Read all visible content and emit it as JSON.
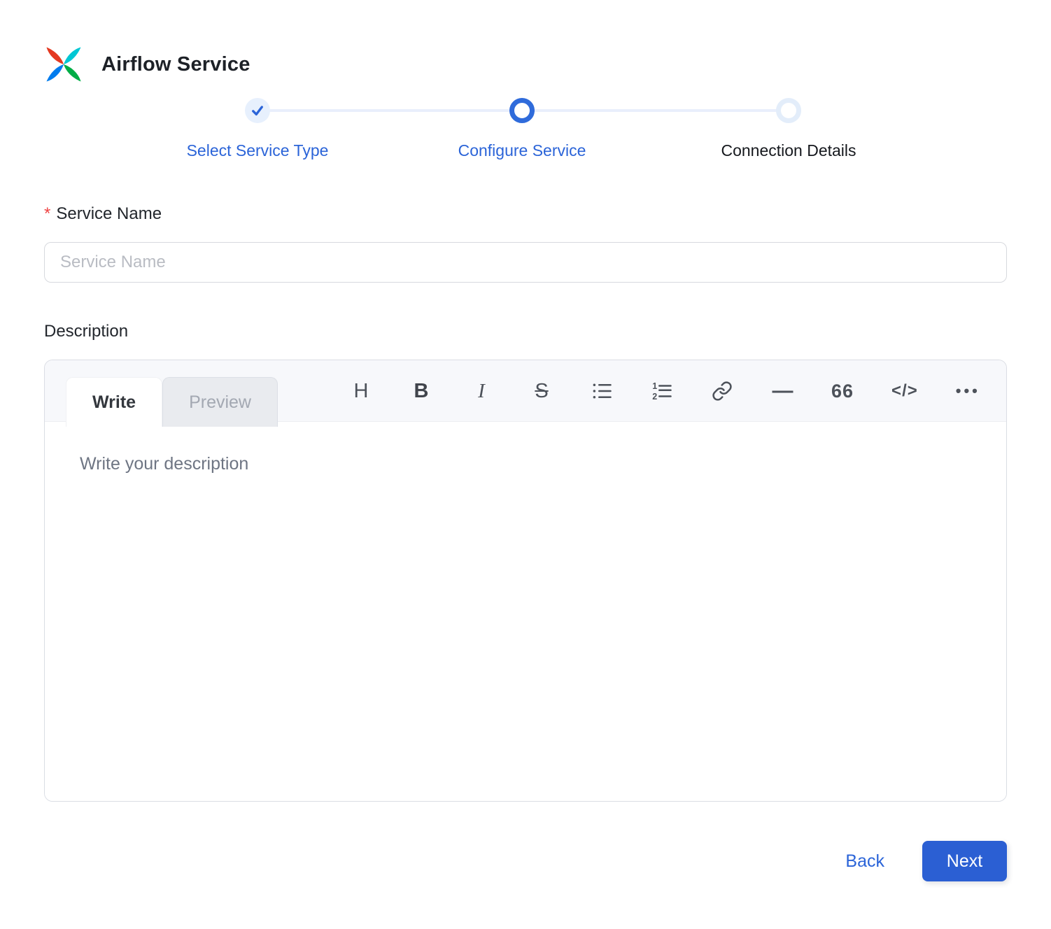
{
  "colors": {
    "primary_blue": "#2b64d8",
    "active_ring_blue": "#2f6bdb",
    "completed_fill": "#e7f0fd",
    "connector": "#e9effc",
    "next_button": "#2b5fd3",
    "required_red": "#ef4444",
    "editor_header_bg": "#f7f8fb",
    "border_gray": "#dadde4"
  },
  "header": {
    "title": "Airflow Service",
    "logo": "airflow-pinwheel-logo"
  },
  "stepper": {
    "steps": [
      {
        "label": "Select Service Type",
        "state": "completed"
      },
      {
        "label": "Configure Service",
        "state": "active"
      },
      {
        "label": "Connection Details",
        "state": "pending"
      }
    ]
  },
  "form": {
    "service_name": {
      "label": "Service Name",
      "required_marker": "*",
      "placeholder": "Service Name",
      "value": ""
    },
    "description": {
      "label": "Description"
    }
  },
  "editor": {
    "tabs": [
      {
        "label": "Write",
        "active": true
      },
      {
        "label": "Preview",
        "active": false
      }
    ],
    "placeholder": "Write your description",
    "content": "",
    "toolbar": [
      {
        "name": "heading",
        "glyph": "H"
      },
      {
        "name": "bold",
        "glyph": "B"
      },
      {
        "name": "italic",
        "glyph": "I"
      },
      {
        "name": "strikethrough",
        "glyph": "S"
      },
      {
        "name": "unordered-list"
      },
      {
        "name": "ordered-list"
      },
      {
        "name": "link"
      },
      {
        "name": "horizontal-rule",
        "glyph": "—"
      },
      {
        "name": "quote",
        "glyph": "66"
      },
      {
        "name": "code",
        "glyph": "&lt;/&gt;"
      },
      {
        "name": "more",
        "glyph": "•••"
      }
    ],
    "code_glyph": "</>",
    "more_glyph": "•••"
  },
  "footer": {
    "back_label": "Back",
    "next_label": "Next"
  }
}
